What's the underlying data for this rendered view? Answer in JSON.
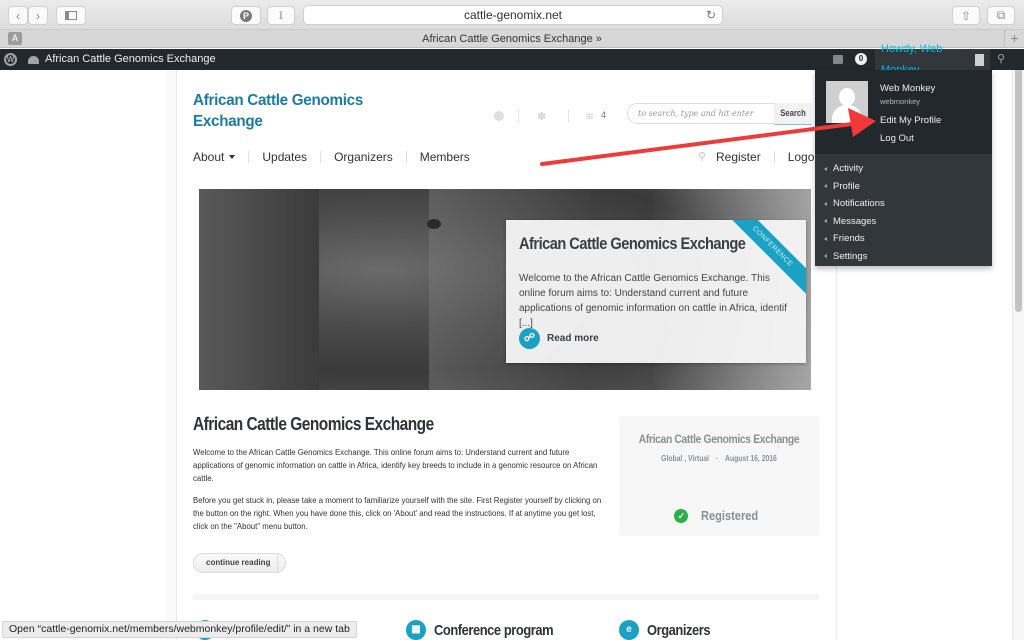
{
  "browser": {
    "url": "cattle-genomix.net",
    "tab_title": "African Cattle Genomics Exchange »",
    "tab_badge": "A",
    "reader_label": "I",
    "new_tab_label": "+"
  },
  "adminbar": {
    "site_name": "African Cattle Genomics Exchange",
    "notification_count": "0",
    "howdy": "Howdy, Web Monkey"
  },
  "account_menu": {
    "display_name": "Web Monkey",
    "username": "webmonkey",
    "edit_profile": "Edit My Profile",
    "log_out": "Log Out",
    "items": [
      {
        "label": "Activity"
      },
      {
        "label": "Profile"
      },
      {
        "label": "Notifications"
      },
      {
        "label": "Messages"
      },
      {
        "label": "Friends"
      },
      {
        "label": "Settings"
      }
    ]
  },
  "site": {
    "title_line1": "African Cattle Genomics",
    "title_line2": "Exchange",
    "rss_count": "4",
    "search_placeholder": "to search, type and hit enter",
    "search_button": "Search",
    "nav": [
      {
        "label": "About",
        "has_dropdown": true
      },
      {
        "label": "Updates"
      },
      {
        "label": "Organizers"
      },
      {
        "label": "Members"
      }
    ],
    "register": "Register",
    "logout": "Logout"
  },
  "hero": {
    "ribbon": "CONFERENCE",
    "title": "African Cattle Genomics Exchange",
    "excerpt": "Welcome to the African Cattle Genomics Exchange. This online forum aims to: Understand current and future applications of genomic information on cattle in Africa, identif [...]",
    "read_more": "Read more"
  },
  "article": {
    "title": "African Cattle Genomics Exchange",
    "paragraph1": "Welcome to the African Cattle Genomics Exchange. This online forum aims to: Understand current and future applications of genomic information on cattle in Africa, identify key breeds to include in a genomic resource on African cattle.",
    "paragraph2": "Before you get stuck in, please take a moment to familiarize yourself with the site. First Register yourself by clicking on the button on the right. When you have done this, click on 'About' and read the instructions. If at anytime you get lost, click on the \"About\" menu button.",
    "continue": "continue reading",
    "continue_arrow": "→"
  },
  "event": {
    "title": "African Cattle Genomics Exchange",
    "location": "Global , Virtual",
    "date": "August 16, 2016",
    "status": "Registered"
  },
  "features": [
    {
      "label": "",
      "icon": "i"
    },
    {
      "label": "Conference program",
      "icon": "calendar"
    },
    {
      "label": "Organizers",
      "icon": "e"
    }
  ],
  "status_bar": "Open “cattle-genomix.net/members/webmonkey/profile/edit/” in a new tab",
  "annotation": {
    "arrow_color": "#f03a3a"
  }
}
